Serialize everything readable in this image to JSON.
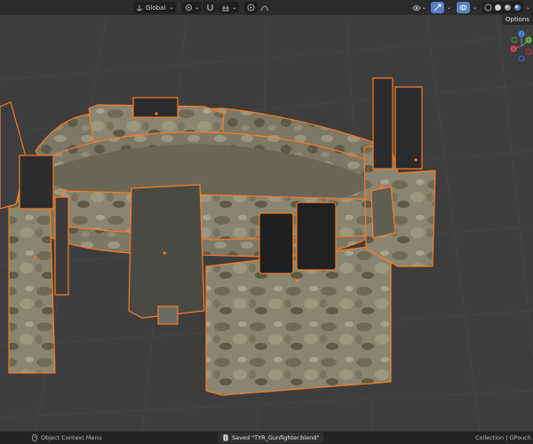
{
  "header": {
    "transform_orientation": "Global",
    "right_panel_tab": "Options"
  },
  "statusbar": {
    "context_menu_label": "Object Context Menu",
    "saved_message": "Saved \"TYR_Gunfighter.blend\"",
    "right_text": "Collection | GPouch"
  },
  "gizmo": {
    "axis_x": "X",
    "axis_y": "Y",
    "axis_z": "Z"
  },
  "colors": {
    "selection_outline": "#ff7a1f",
    "active_button": "#5680c2",
    "viewport_bg": "#3d3d3d",
    "axis_x": "#e0455b",
    "axis_y": "#6fb54a",
    "axis_z": "#4c8fe8"
  }
}
